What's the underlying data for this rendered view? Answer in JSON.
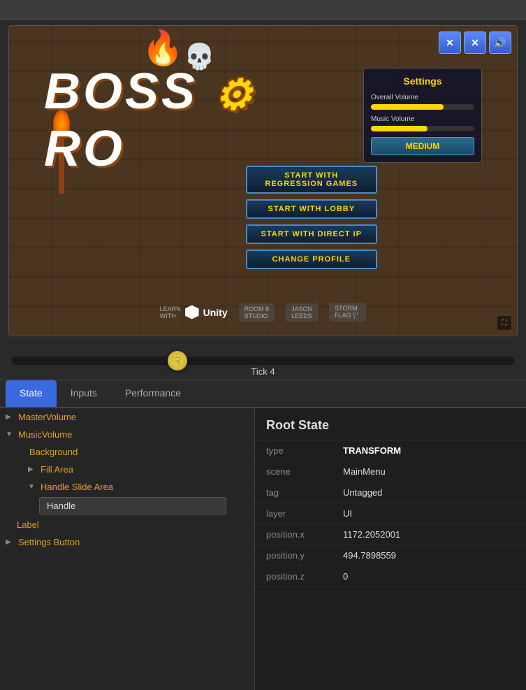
{
  "topbar": {},
  "gamePreview": {
    "title": "BOSS RO",
    "settings": {
      "title": "Settings",
      "overallVolumeLabel": "Overall Volume",
      "musicVolumeLabel": "Music Volume",
      "qualityLabel": "MEDIUM",
      "overallFill": 70,
      "musicFill": 55
    },
    "menuButtons": [
      "START WITH\nREGRESSION GAMES",
      "START WITH LOBBY",
      "START WITH DIRECT IP",
      "CHANGE PROFILE"
    ],
    "bottomLogos": [
      {
        "name": "LEARN WITH",
        "logo": "Unity"
      },
      {
        "name": "ROOM 8 STUDIO"
      },
      {
        "name": "JASON LEEDS"
      },
      {
        "name": "STORM FLAG"
      }
    ]
  },
  "timeline": {
    "tickLabel": "Tick 4"
  },
  "tabs": [
    {
      "label": "State",
      "active": true
    },
    {
      "label": "Inputs",
      "active": false
    },
    {
      "label": "Performance",
      "active": false
    }
  ],
  "treeItems": [
    {
      "label": "MasterVolume",
      "indent": 0,
      "arrow": "▶",
      "expanded": false
    },
    {
      "label": "MusicVolume",
      "indent": 0,
      "arrow": "▼",
      "expanded": true
    },
    {
      "label": "Background",
      "indent": 1,
      "arrow": "",
      "expanded": false
    },
    {
      "label": "Fill Area",
      "indent": 2,
      "arrow": "▶",
      "expanded": false
    },
    {
      "label": "Handle Slide Area",
      "indent": 2,
      "arrow": "▼",
      "expanded": true
    },
    {
      "label": "Handle",
      "indent": 3,
      "isHandle": true
    },
    {
      "label": "Label",
      "indent": 1,
      "arrow": ""
    },
    {
      "label": "Settings Button",
      "indent": 0,
      "arrow": "▶"
    }
  ],
  "rootState": {
    "title": "Root State",
    "properties": [
      {
        "key": "type",
        "value": "TRANSFORM"
      },
      {
        "key": "scene",
        "value": "MainMenu"
      },
      {
        "key": "tag",
        "value": "Untagged"
      },
      {
        "key": "layer",
        "value": "UI"
      },
      {
        "key": "position.x",
        "value": "1172.2052001"
      },
      {
        "key": "position.y",
        "value": "494.7898559"
      },
      {
        "key": "position.z",
        "value": "0"
      }
    ]
  },
  "colors": {
    "accent": "#3a6adf",
    "treeText": "#e0a020",
    "propKey": "#888888",
    "propVal": "#dddddd"
  },
  "icons": {
    "close": "✕",
    "audio": "🔊",
    "expand": "⛶",
    "arrowRight": "▶",
    "arrowDown": "▼"
  }
}
